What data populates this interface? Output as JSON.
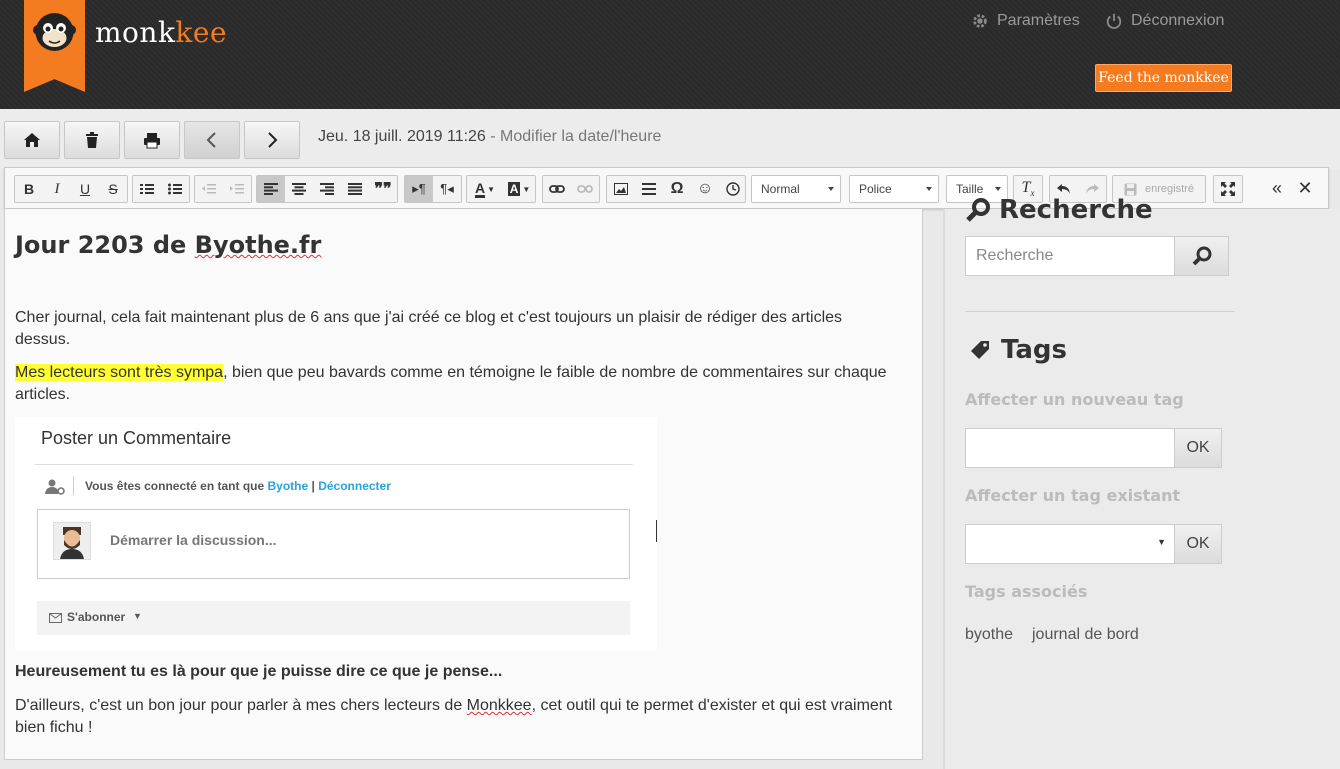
{
  "header": {
    "logo_text_main": "monk",
    "logo_text_accent": "kee",
    "settings_label": "Paramètres",
    "logout_label": "Déconnexion",
    "feed_button": "Feed the monkkee"
  },
  "nav": {
    "date": "Jeu. 18 juill. 2019 11:26",
    "separator": " - ",
    "modify_date": "Modifier la date/l'heure"
  },
  "toolbar": {
    "bold": "B",
    "italic": "I",
    "underline": "U",
    "strike": "S",
    "format_select": "Normal",
    "font_select": "Police",
    "size_select": "Taille",
    "save_label": "enregistré"
  },
  "entry": {
    "title_prefix": "Jour 2203 de ",
    "title_site": "Byothe.fr",
    "para1": "Cher journal, cela fait maintenant plus de 6 ans que j'ai créé ce blog et c'est toujours un plaisir de rédiger des articles dessus.",
    "para2_highlight": "Mes lecteurs sont très sympa",
    "para2_rest": ", bien que peu bavards comme en témoigne le faible de nombre de commentaires sur chaque articles.",
    "bold_line": "Heureusement tu es là pour que je puisse dire ce que je pense...",
    "para3_start": "D'ailleurs, c'est un bon jour pour parler à mes chers lecteurs de ",
    "para3_link": "Monkkee",
    "para3_end": ", cet outil qui te permet d'exister et qui est vraiment bien fichu !"
  },
  "embed": {
    "heading": "Poster un Commentaire",
    "connected_text": "Vous êtes connecté en tant que ",
    "user": "Byothe",
    "sep": " | ",
    "disconnect": "Déconnecter",
    "start": "Démarrer la discussion...",
    "subscribe": "S'abonner"
  },
  "sidebar": {
    "search_title": "Recherche",
    "search_placeholder": "Recherche",
    "tags_title": "Tags",
    "new_tag_label": "Affecter un nouveau tag",
    "ok": "OK",
    "existing_tag_label": "Affecter un tag existant",
    "assoc_label": "Tags associés",
    "tags": [
      "byothe",
      "journal de bord"
    ]
  },
  "colors": {
    "brand_orange": "#f47b20",
    "highlight": "#ffff33",
    "link_blue": "#2aa3d8"
  }
}
